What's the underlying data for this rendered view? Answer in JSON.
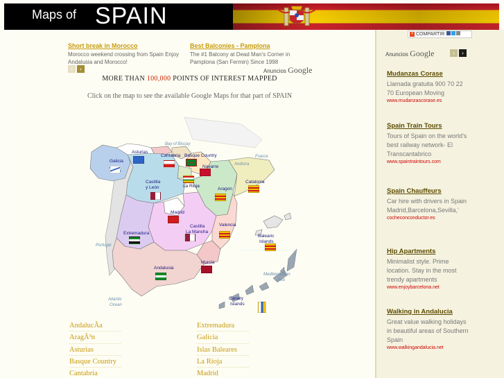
{
  "header": {
    "logo_small": "Maps of",
    "logo_big": "SPAIN"
  },
  "top_ads": [
    {
      "title": "Short break in Morocco",
      "desc": "Morocco weekend crossing from Spain Enjoy Andalusia and Morocco!"
    },
    {
      "title": "Best Balconies - Pamplona",
      "desc": "The #1 Balcony at Dead Man's Corner in Pamplona (San Fermin) Since 1998"
    }
  ],
  "adsense": {
    "label": "Anuncios",
    "brand": "Google"
  },
  "headline": {
    "prefix": "MORE THAN ",
    "number": "100,000",
    "suffix": " POINTS OF INTEREST MAPPED"
  },
  "subline": "Click on the map to see the available Google Maps for that part of SPAIN",
  "map": {
    "regions": [
      "Galicia",
      "Asturias",
      "Cantabria",
      "Basque Country",
      "Navarre",
      "Castilla",
      "y León",
      "La Rioja",
      "Aragon",
      "Catalonia",
      "Madrid",
      "Extremadura",
      "Castilla",
      "La Mancha",
      "Valencia",
      "Balearic",
      "Islands",
      "Murcia",
      "Andalusia",
      "Canary",
      "Islands"
    ],
    "seas": {
      "bay": "Bay of Biscay",
      "france": "France",
      "andorra": "Andorra",
      "portugal": "Portugal",
      "med": "Mediterranean",
      "sea": "Sea",
      "atl1": "Atlantic",
      "ocean1": "Ocean",
      "atl2": "Atlantic",
      "ocean2": "Ocean"
    }
  },
  "region_links": {
    "col1": [
      "AndalucÃ­a",
      "AragÃ³n",
      "Asturias",
      "Basque Country",
      "Cantabria"
    ],
    "col2": [
      "Extremadura",
      "Galicia",
      "Islas Baleares",
      "La Rioja",
      "Madrid"
    ]
  },
  "sidebar": {
    "share_label": "COMPARTIR",
    "anuncios": "Anuncios",
    "brand": "Google",
    "ads": [
      {
        "title": "Mudanzas Corase",
        "desc": "Llamada gratuita 900 70 22 70 European Moving",
        "url": "www.mudanzascorase.es"
      },
      {
        "title": "Spain Train Tours",
        "desc": "Tours of Spain on the world's best railway network- El Transcantabrico",
        "url": "www.spaintraintours.com"
      },
      {
        "title": "Spain Chauffeurs",
        "desc": "Car hire with drivers in Spain Madrid,Barcelona,Sevilla,'",
        "url": "cocheconconductor.es"
      },
      {
        "title": "Hip Apartments",
        "desc": "Minimalist style. Prime location. Stay in the most trendy apartments",
        "url": "www.enjoybarcelona.net"
      },
      {
        "title": "Walking in Andalucia",
        "desc": "Great value walking holidays in beautiful areas of Southern Spain",
        "url": "www.walkingandalucia.net"
      }
    ]
  },
  "colors": {
    "link_gold": "#c79a0c",
    "headline_red": "#cc2200",
    "sidebar_bg": "#f5f3e0",
    "ad_title": "#5c4a00",
    "ad_url": "#cc0000"
  }
}
